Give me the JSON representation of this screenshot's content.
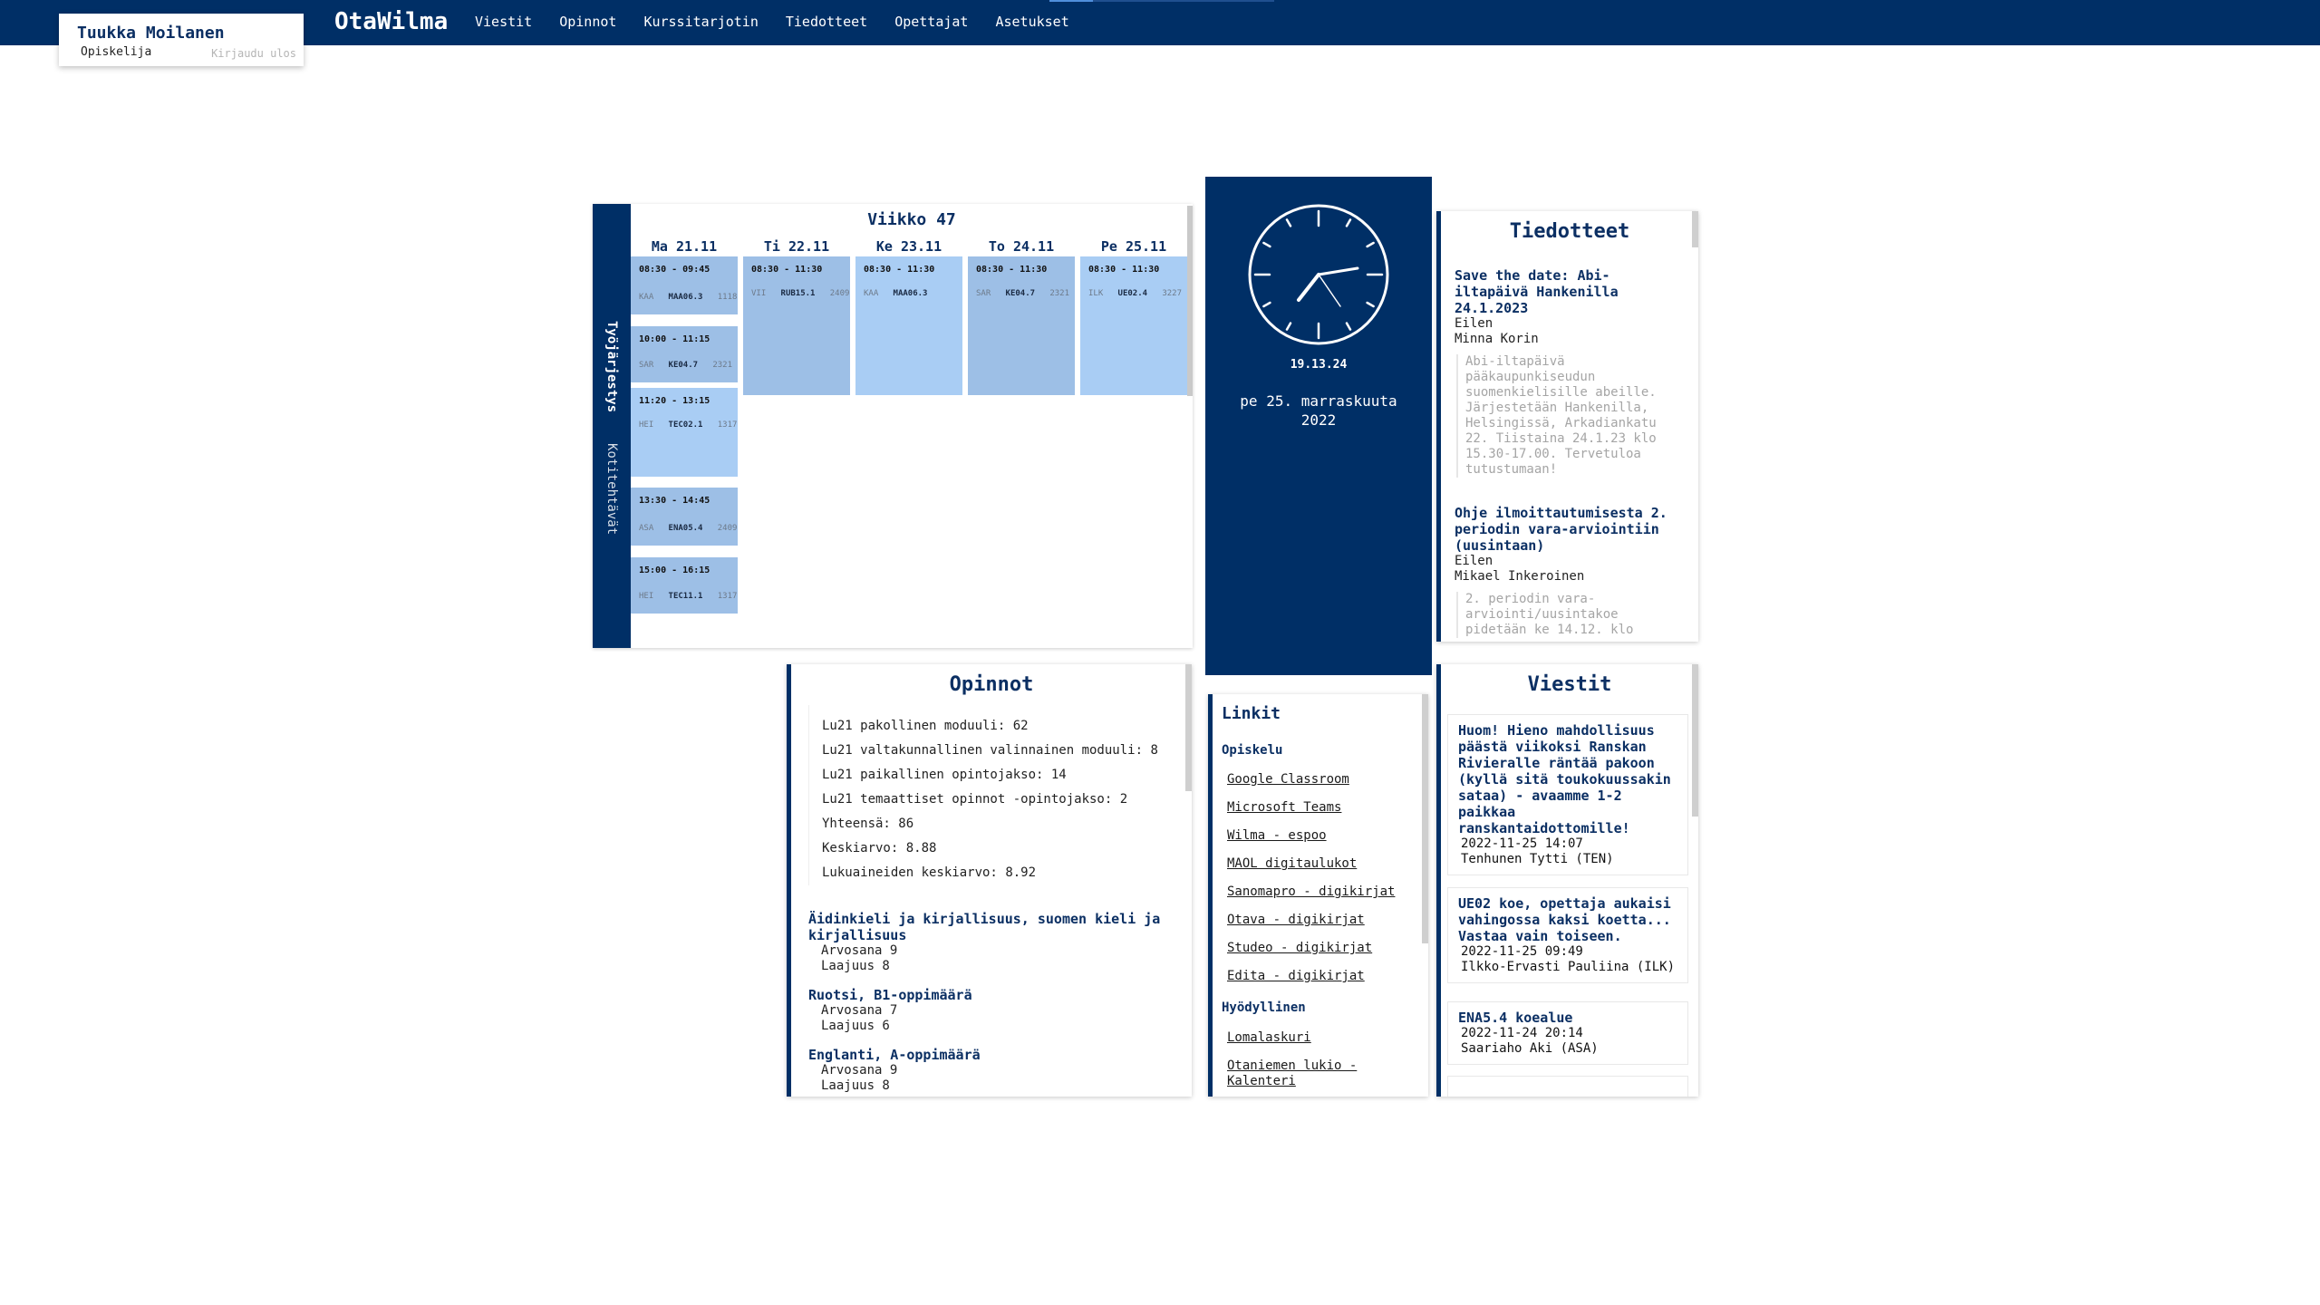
{
  "user": {
    "name": "Tuukka Moilanen",
    "role": "Opiskelija",
    "logout": "Kirjaudu ulos"
  },
  "app": {
    "brand": "OtaWilma"
  },
  "nav": [
    "Viestit",
    "Opinnot",
    "Kurssitarjotin",
    "Tiedotteet",
    "Opettajat",
    "Asetukset"
  ],
  "schedule": {
    "title": "Viikko 47",
    "tabs": [
      "Työjärjestys",
      "Kotitehtävät"
    ],
    "days": [
      "Ma 21.11",
      "Ti 22.11",
      "Ke 23.11",
      "To 24.11",
      "Pe 25.11"
    ],
    "lessons": [
      {
        "time": "08:30 - 09:45",
        "teacher": "KAA",
        "course": "MAA06.3",
        "room": "1118"
      },
      {
        "time": "10:00 - 11:15",
        "teacher": "SAR",
        "course": "KE04.7",
        "room": "2321"
      },
      {
        "time": "11:20 - 13:15",
        "teacher": "HEI",
        "course": "TEC02.1",
        "room": "1317"
      },
      {
        "time": "13:30 - 14:45",
        "teacher": "ASA",
        "course": "ENA05.4",
        "room": "2409"
      },
      {
        "time": "15:00 - 16:15",
        "teacher": "HEI",
        "course": "TEC11.1",
        "room": "1317"
      },
      {
        "time": "08:30 - 11:30",
        "teacher": "VII",
        "course": "RUB15.1",
        "room": "2409"
      },
      {
        "time": "08:30 - 11:30",
        "teacher": "KAA",
        "course": "MAA06.3",
        "room": ""
      },
      {
        "time": "08:30 - 11:30",
        "teacher": "SAR",
        "course": "KE04.7",
        "room": "2321"
      },
      {
        "time": "08:30 - 11:30",
        "teacher": "ILK",
        "course": "UE02.4",
        "room": "3227"
      }
    ]
  },
  "clock": {
    "digital": "19.13.24",
    "date_line1": "pe 25. marraskuuta",
    "date_line2": "2022"
  },
  "announcements": {
    "title": "Tiedotteet",
    "items": [
      {
        "title": "Save the date: Abi-iltapäivä Hankenilla 24.1.2023",
        "when": "Eilen",
        "author": "Minna Korin",
        "body": "Abi-iltapäivä pääkaupunkiseudun suomenkielisille abeille. Järjestetään Hankenilla, Helsingissä, Arkadiankatu 22. Tiistaina 24.1.23 klo 15.30-17.00. Tervetuloa tutustumaan!"
      },
      {
        "title": "Ohje ilmoittautumisesta 2. periodin vara-arviointiin (uusintaan)",
        "when": "Eilen",
        "author": "Mikael Inkeroinen",
        "body": "2. periodin vara-arviointi/uusintakoe pidetään ke 14.12. klo"
      }
    ]
  },
  "studies": {
    "title": "Opinnot",
    "stats": [
      {
        "label": "Lu21 pakollinen moduuli:",
        "value": "62"
      },
      {
        "label": "Lu21 valtakunnallinen valinnainen moduuli:",
        "value": "8"
      },
      {
        "label": "Lu21 paikallinen opintojakso:",
        "value": "14"
      },
      {
        "label": "Lu21 temaattiset opinnot -opintojakso:",
        "value": "2"
      },
      {
        "label": "Yhteensä:",
        "value": "86"
      },
      {
        "label": "Keskiarvo:",
        "value": "8.88"
      },
      {
        "label": "Lukuaineiden keskiarvo:",
        "value": "8.92"
      }
    ],
    "subjects": [
      {
        "name": "Äidinkieli ja kirjallisuus, suomen kieli ja kirjallisuus",
        "grade": "Arvosana 9",
        "scope": "Laajuus 8"
      },
      {
        "name": "Ruotsi, B1-oppimäärä",
        "grade": "Arvosana 7",
        "scope": "Laajuus 6"
      },
      {
        "name": "Englanti, A-oppimäärä",
        "grade": "Arvosana 9",
        "scope": "Laajuus 8"
      }
    ]
  },
  "links": {
    "title": "Linkit",
    "sections": [
      {
        "name": "Opiskelu",
        "items": [
          "Google Classroom",
          "Microsoft Teams",
          "Wilma - espoo",
          "MAOL digitaulukot",
          "Sanomapro - digikirjat",
          "Otava - digikirjat",
          "Studeo - digikirjat",
          "Edita - digikirjat"
        ]
      },
      {
        "name": "Hyödyllinen",
        "items": [
          "Lomalaskuri",
          "Otaniemen lukio - Kalenteri"
        ]
      }
    ]
  },
  "messages": {
    "title": "Viestit",
    "items": [
      {
        "title": "Huom! Hieno mahdollisuus päästä viikoksi Ranskan Rivieralle räntää pakoon (kyllä sitä toukokuussakin sataa) - avaamme 1-2 paikkaa ranskantaidottomille!",
        "date": "2022-11-25 14:07",
        "sender": "Tenhunen Tytti (TEN)"
      },
      {
        "title": "UE02 koe, opettaja aukaisi vahingossa kaksi koetta... Vastaa vain toiseen.",
        "date": "2022-11-25 09:49",
        "sender": "Ilkko-Ervasti Pauliina (ILK)"
      },
      {
        "title": "ENA5.4 koealue",
        "date": "2022-11-24 20:14",
        "sender": "Saariaho Aki (ASA)"
      }
    ]
  },
  "colors": {
    "primary": "#002f66",
    "accent_text": "#0b2f63",
    "lesson": "#9dbfe6",
    "lesson_light": "#a9cdf4"
  },
  "icons": [
    "analog-clock-icon"
  ]
}
